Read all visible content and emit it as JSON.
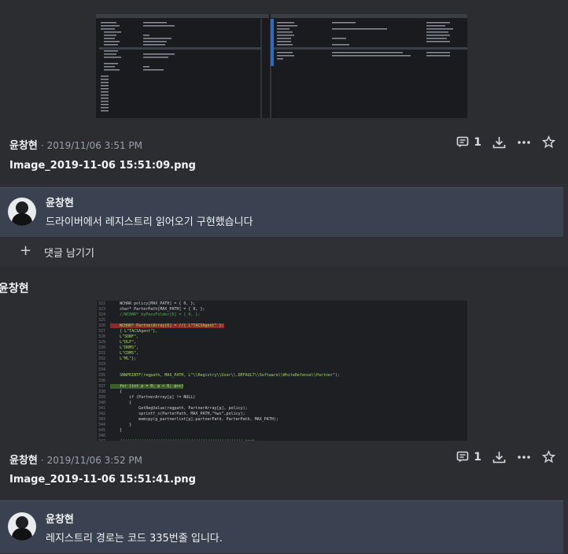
{
  "posts": [
    {
      "author": "윤창현",
      "date": "· 2019/11/06 3:51 PM",
      "filename": "Image_2019-11-06 15:51:09.png",
      "comment_count": "1",
      "comment": {
        "author": "윤창현",
        "text": "드라이버에서 레지스트리 읽어오기 구현했습니다"
      },
      "leave_comment": "댓글 남기기"
    },
    {
      "header_author": "윤창현",
      "author": "윤창현",
      "date": "· 2019/11/06 3:52 PM",
      "filename": "Image_2019-11-06 15:51:41.png",
      "comment_count": "1",
      "comment": {
        "author": "윤창현",
        "text": "레지스트리 경로는 코드 335번줄 입니다."
      }
    }
  ],
  "code_lines": [
    {
      "n": "322",
      "t": "WCHAR policy[MAX_PATH] = { 0, };"
    },
    {
      "n": "323",
      "t": "char* ParterPath[MAX_PATH] = { 0, };"
    },
    {
      "n": "324",
      "t": "//WCHAR* byPassFolder[6] = { 0, };"
    },
    {
      "n": "325",
      "t": ""
    },
    {
      "n": "326",
      "t": "WCHAR* PartnerArray[6] = //{ L\"TACSAgent\" };"
    },
    {
      "n": "327",
      "t": "{ L\"TACSAgent\"},"
    },
    {
      "n": "328",
      "t": "L\"SDNF\","
    },
    {
      "n": "329",
      "t": "L\"DLP\","
    },
    {
      "n": "330",
      "t": "L\"DRMS\","
    },
    {
      "n": "331",
      "t": "L\"CDMS\","
    },
    {
      "n": "332",
      "t": "L\"ML\"};"
    },
    {
      "n": "333",
      "t": ""
    },
    {
      "n": "334",
      "t": ""
    },
    {
      "n": "335",
      "t": "SNWPRINTF(regpath, MAX_PATH, L\"\\\\Registry\\\\User\\\\.DEFAULT\\\\Software\\\\WhiteDefense\\\\Partner\");"
    },
    {
      "n": "336",
      "t": ""
    },
    {
      "n": "337",
      "t": "for (int p = 0; p < 6; p++)"
    },
    {
      "n": "338",
      "t": "{"
    },
    {
      "n": "339",
      "t": "    if (PartnerArray[p] != NULL)"
    },
    {
      "n": "340",
      "t": "    {"
    },
    {
      "n": "341",
      "t": "        GetRegValue(regpath, PartnerArray[p], policy);"
    },
    {
      "n": "342",
      "t": "        sprintf_s(ParterPath, MAX_PATH,\"%ws\",policy);"
    },
    {
      "n": "343",
      "t": "        memcpy(g_partnerlist[p].partnerPath, ParterPath, MAX_PATH);"
    },
    {
      "n": "344",
      "t": "    }"
    },
    {
      "n": "345",
      "t": "}"
    },
    {
      "n": "346",
      "t": ""
    },
    {
      "n": "347",
      "t": "//////////////////////////////////////////////////// test"
    }
  ]
}
